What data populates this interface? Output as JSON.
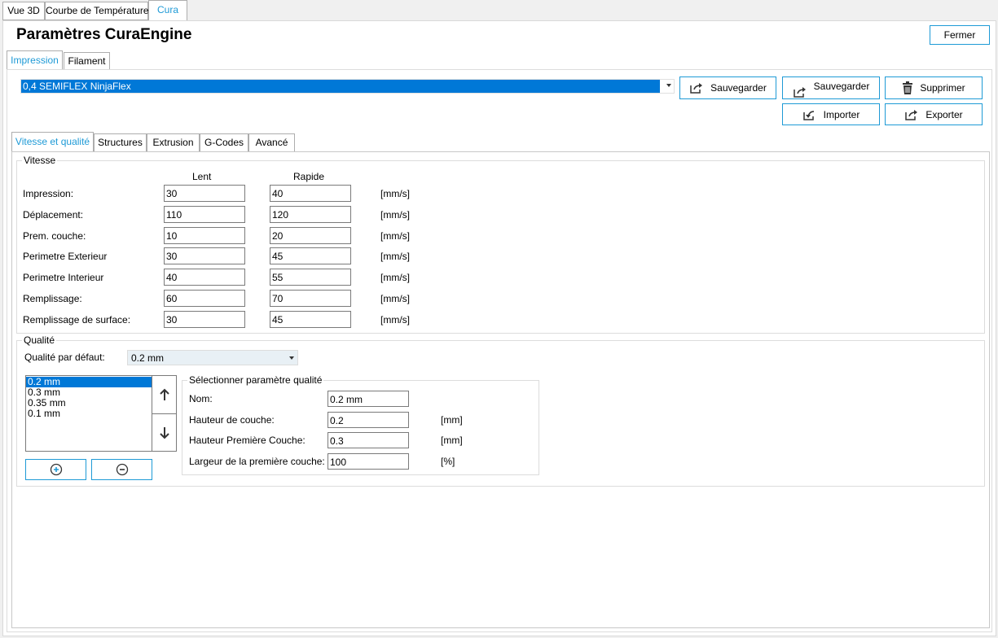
{
  "top_tabs": [
    {
      "label": "Vue 3D"
    },
    {
      "label": "Courbe de Température"
    },
    {
      "label": "Cura"
    }
  ],
  "header": {
    "title": "Paramètres CuraEngine",
    "close_label": "Fermer"
  },
  "sub_tabs": [
    {
      "label": "Impression"
    },
    {
      "label": "Filament"
    }
  ],
  "profile": {
    "selected": "0,4 SEMIFLEX NinjaFlex"
  },
  "actions": {
    "save1": "Sauvegarder",
    "save2": "Sauvegarder",
    "delete": "Supprimer",
    "import": "Importer",
    "export": "Exporter"
  },
  "settings_tabs": [
    {
      "label": "Vitesse et qualité"
    },
    {
      "label": "Structures"
    },
    {
      "label": "Extrusion"
    },
    {
      "label": "G-Codes"
    },
    {
      "label": "Avancé"
    }
  ],
  "speed": {
    "title": "Vitesse",
    "col_slow": "Lent",
    "col_fast": "Rapide",
    "rows": [
      {
        "label": "Impression:",
        "slow": "30",
        "fast": "40",
        "unit": "[mm/s]"
      },
      {
        "label": "Déplacement:",
        "slow": "110",
        "fast": "120",
        "unit": "[mm/s]"
      },
      {
        "label": "Prem. couche:",
        "slow": "10",
        "fast": "20",
        "unit": "[mm/s]"
      },
      {
        "label": "Perimetre Exterieur",
        "slow": "30",
        "fast": "45",
        "unit": "[mm/s]"
      },
      {
        "label": "Perimetre Interieur",
        "slow": "40",
        "fast": "55",
        "unit": "[mm/s]"
      },
      {
        "label": "Remplissage:",
        "slow": "60",
        "fast": "70",
        "unit": "[mm/s]"
      },
      {
        "label": "Remplissage de surface:",
        "slow": "30",
        "fast": "45",
        "unit": "[mm/s]"
      }
    ]
  },
  "quality": {
    "title": "Qualité",
    "default_label": "Qualité par défaut:",
    "default_value": "0.2 mm",
    "list": [
      "0.2 mm",
      "0.3 mm",
      "0.35 mm",
      "0.1 mm"
    ],
    "params_title": "Sélectionner paramètre qualité",
    "params": [
      {
        "label": "Nom:",
        "value": "0.2 mm",
        "unit": ""
      },
      {
        "label": "Hauteur de couche:",
        "value": "0.2",
        "unit": "[mm]"
      },
      {
        "label": "Hauteur Première Couche:",
        "value": "0.3",
        "unit": "[mm]"
      },
      {
        "label": "Largeur de la première couche:",
        "value": "100",
        "unit": "[%]"
      }
    ]
  },
  "colors": {
    "accent": "#1e9ad6",
    "selection": "#0078d7"
  }
}
